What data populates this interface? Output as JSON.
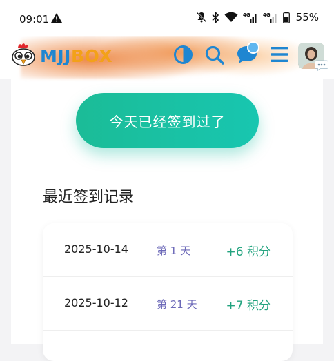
{
  "status_bar": {
    "time": "09:01",
    "battery": "55%",
    "net1": "4G",
    "net2": "4G"
  },
  "header": {
    "logo_part1": "MJJ",
    "logo_part2": "BOX",
    "colors": {
      "mjj": "#1f86d1",
      "box": "#f3a119",
      "icon": "#1f86d1"
    },
    "icons": [
      "theme-toggle-icon",
      "search-icon",
      "chat-icon",
      "menu-icon"
    ]
  },
  "checkin": {
    "button_label": "今天已经签到过了",
    "accent": "#1bbc97"
  },
  "history": {
    "title": "最近签到记录",
    "rows": [
      {
        "date": "2025-10-14",
        "day": "第 1 天",
        "points": "+6 积分"
      },
      {
        "date": "2025-10-12",
        "day": "第 21 天",
        "points": "+7 积分"
      }
    ]
  }
}
